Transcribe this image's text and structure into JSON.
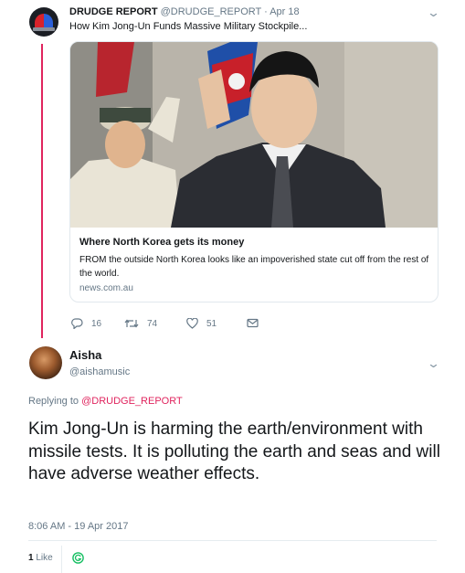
{
  "quoted_tweet": {
    "author_name": "DRUDGE REPORT",
    "author_handle": "@DRUDGE_REPORT",
    "date": "Apr 18",
    "text": "How Kim Jong-Un Funds Massive Military Stockpile...",
    "card": {
      "title": "Where North Korea gets its money",
      "description": "FROM the outside North Korea looks like an impoverished state cut off from the rest of the world.",
      "domain": "news.com.au"
    },
    "actions": {
      "replies": "16",
      "retweets": "74",
      "likes": "51"
    }
  },
  "main_tweet": {
    "author_name": "Aisha",
    "author_handle": "@aishamusic",
    "replying_to_label": "Replying to",
    "replying_to_mention": "@DRUDGE_REPORT",
    "text": "Kim Jong-Un is harming the earth/environment with missile tests. It is polluting the earth and seas and will have adverse weather effects.",
    "timestamp": "8:06 AM - 19 Apr 2017",
    "like_count": "1",
    "like_label": "Like"
  },
  "icons": [
    "siren-avatar",
    "chevron-down-icon",
    "reply-icon",
    "retweet-icon",
    "heart-icon",
    "envelope-icon"
  ],
  "colors": {
    "thread_line": "#e0245e",
    "mention": "#e0245e",
    "secondary_text": "#657786",
    "liker_avatar": "#17bf63"
  }
}
